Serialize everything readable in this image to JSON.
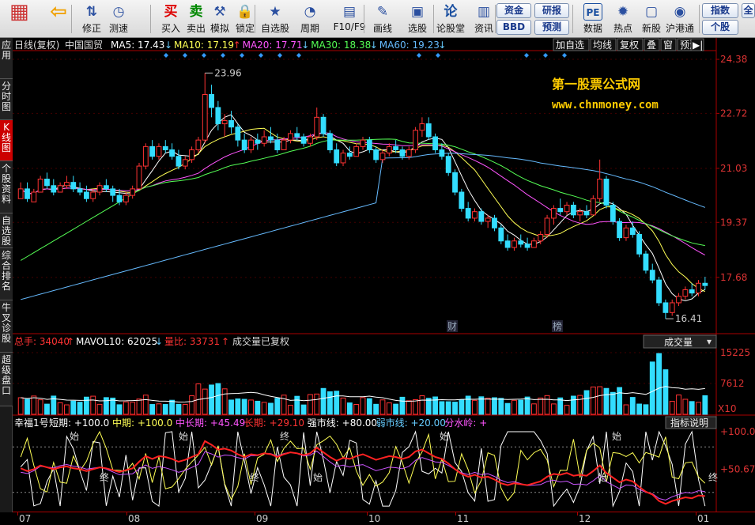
{
  "toolbar": {
    "items": [
      {
        "label": "",
        "icon": "grid-icon"
      },
      {
        "label": "",
        "icon": "back-arrow-icon"
      },
      {
        "label": "修正",
        "icon": "up-down-arrow-icon"
      },
      {
        "label": "测速",
        "icon": "clock-icon"
      },
      {
        "label": "买入",
        "icon": "buy-icon",
        "glyph": "买"
      },
      {
        "label": "卖出",
        "icon": "sell-icon",
        "glyph": "卖"
      },
      {
        "label": "模拟",
        "icon": "hammer-icon"
      },
      {
        "label": "锁定",
        "icon": "lock-icon"
      },
      {
        "label": "自选股",
        "icon": "star-folder-icon"
      },
      {
        "label": "周期",
        "icon": "cycle-icon"
      },
      {
        "label": "F10/F9",
        "icon": "f10-icon"
      },
      {
        "label": "画线",
        "icon": "pen-icon"
      },
      {
        "label": "选股",
        "icon": "select-icon"
      },
      {
        "label": "论股堂",
        "icon": "lungu-icon",
        "glyph": "论"
      },
      {
        "label": "资讯",
        "icon": "news-icon"
      },
      {
        "label": "数据",
        "icon": "pe-icon",
        "glyph": "PE"
      },
      {
        "label": "热点",
        "icon": "hot-icon"
      },
      {
        "label": "新股",
        "icon": "new-stock-icon"
      },
      {
        "label": "沪港通",
        "icon": "hk-connect-icon"
      }
    ],
    "pills": [
      "资金",
      "研报",
      "BBD",
      "预测",
      "指数",
      "个股",
      "全"
    ]
  },
  "left_tabs": [
    "应用",
    "分时图",
    "K线图",
    "个股资料",
    "自选股",
    "综合排名",
    "牛叉诊股",
    "超级盘口"
  ],
  "kline": {
    "period": "日线(复权)",
    "stock": "中国国贸",
    "ma": [
      {
        "name": "MA5",
        "value": "17.43",
        "color": "#ffffff"
      },
      {
        "name": "MA10",
        "value": "17.19",
        "color": "#ffff55"
      },
      {
        "name": "MA20",
        "value": "17.71",
        "color": "#ff55ff"
      },
      {
        "name": "MA30",
        "value": "18.38",
        "color": "#55ff55"
      },
      {
        "name": "MA60",
        "value": "19.23",
        "color": "#66bbff"
      }
    ],
    "right_buttons": [
      "加自选",
      "均线",
      "复权",
      "叠",
      "窗",
      "预测"
    ],
    "price_ticks": [
      "24.38",
      "22.72",
      "21.03",
      "19.37",
      "17.68"
    ],
    "high_label": "23.96",
    "low_label": "16.41",
    "event_marks": [
      "财",
      "榜"
    ],
    "watermark_title": "第一股票公式网",
    "watermark_url": "www.chnmoney.com"
  },
  "volume": {
    "total": "总手: 34040",
    "mavol": "MAVOL10: 62025",
    "ratio": "量比: 33731",
    "note": "成交量已复权",
    "select": "成交量",
    "ticks": [
      "15225",
      "7612",
      "X10"
    ]
  },
  "indicator": {
    "name": "幸福1号",
    "items": [
      {
        "label": "短期: +100.0",
        "color": "#ffffff"
      },
      {
        "label": "中期: +100.0",
        "color": "#ffff55"
      },
      {
        "label": "中长期: +45.49",
        "color": "#ff55ff"
      },
      {
        "label": "长期: +29.10",
        "color": "#ff3333"
      },
      {
        "label": "强市线: +80.00",
        "color": "#ffffff"
      },
      {
        "label": "弱市线: +20.00",
        "color": "#66ccff"
      },
      {
        "label": "分水岭: +",
        "color": "#ff55ff"
      }
    ],
    "help": "指标说明",
    "ticks": [
      "100.0",
      "50.67"
    ],
    "marks": [
      "始",
      "终",
      "始",
      "终",
      "终",
      "始",
      "始",
      "始",
      "始",
      "终"
    ]
  },
  "xaxis": [
    "07",
    "08",
    "09",
    "10",
    "11",
    "12",
    "01"
  ],
  "chart_data": {
    "type": "candlestick",
    "stock": "中国国贸",
    "note": "approximate daily OHLC read from chart",
    "ylim": [
      16.0,
      24.6
    ],
    "ohlc": [
      [
        20.1,
        20.6,
        20.3,
        20.4
      ],
      [
        20.4,
        20.6,
        20.0,
        20.1
      ],
      [
        20.0,
        20.4,
        20.2,
        20.3
      ],
      [
        20.3,
        20.8,
        20.6,
        20.7
      ],
      [
        20.7,
        20.9,
        20.4,
        20.5
      ],
      [
        20.5,
        20.7,
        20.2,
        20.3
      ],
      [
        20.3,
        20.6,
        20.4,
        20.5
      ],
      [
        20.5,
        20.8,
        20.4,
        20.6
      ],
      [
        20.6,
        20.8,
        20.3,
        20.4
      ],
      [
        20.4,
        20.6,
        20.2,
        20.3
      ],
      [
        20.3,
        20.5,
        20.0,
        20.1
      ],
      [
        20.1,
        20.4,
        20.0,
        20.3
      ],
      [
        20.3,
        20.6,
        20.2,
        20.5
      ],
      [
        20.5,
        20.7,
        20.3,
        20.4
      ],
      [
        20.4,
        20.5,
        20.0,
        20.2
      ],
      [
        20.2,
        20.4,
        19.9,
        20.0
      ],
      [
        20.0,
        20.3,
        19.9,
        20.2
      ],
      [
        20.2,
        20.5,
        20.1,
        20.4
      ],
      [
        20.4,
        21.2,
        20.4,
        21.1
      ],
      [
        21.1,
        21.8,
        21.0,
        21.7
      ],
      [
        21.7,
        21.9,
        21.3,
        21.4
      ],
      [
        21.4,
        21.8,
        21.3,
        21.7
      ],
      [
        21.7,
        21.9,
        21.5,
        21.6
      ],
      [
        21.6,
        21.8,
        21.3,
        21.4
      ],
      [
        21.4,
        21.6,
        21.0,
        21.1
      ],
      [
        21.1,
        21.4,
        21.0,
        21.3
      ],
      [
        21.3,
        21.7,
        21.2,
        21.6
      ],
      [
        21.6,
        22.0,
        21.5,
        21.9
      ],
      [
        21.9,
        23.96,
        21.8,
        23.3
      ],
      [
        23.3,
        23.6,
        22.6,
        22.9
      ],
      [
        22.9,
        23.1,
        22.2,
        22.4
      ],
      [
        22.4,
        22.7,
        22.0,
        22.5
      ],
      [
        22.5,
        22.8,
        22.1,
        22.3
      ],
      [
        22.3,
        22.4,
        21.7,
        21.9
      ],
      [
        21.9,
        22.1,
        21.5,
        21.6
      ],
      [
        21.6,
        22.0,
        21.5,
        21.9
      ],
      [
        21.9,
        22.1,
        21.6,
        21.8
      ],
      [
        21.8,
        22.2,
        21.7,
        22.0
      ],
      [
        22.0,
        22.3,
        21.8,
        21.9
      ],
      [
        21.9,
        22.1,
        21.5,
        21.6
      ],
      [
        21.6,
        22.0,
        21.6,
        21.9
      ],
      [
        21.9,
        22.2,
        21.8,
        22.1
      ],
      [
        22.1,
        22.3,
        21.9,
        22.0
      ],
      [
        22.0,
        22.1,
        21.7,
        21.8
      ],
      [
        21.8,
        22.1,
        21.7,
        22.0
      ],
      [
        22.0,
        22.9,
        21.9,
        22.6
      ],
      [
        22.6,
        22.7,
        22.0,
        22.1
      ],
      [
        22.1,
        22.2,
        21.5,
        21.6
      ],
      [
        21.6,
        21.8,
        21.1,
        21.2
      ],
      [
        21.2,
        21.6,
        21.1,
        21.5
      ],
      [
        21.5,
        21.7,
        21.3,
        21.4
      ],
      [
        21.4,
        21.8,
        21.4,
        21.7
      ],
      [
        21.7,
        22.0,
        21.6,
        21.9
      ],
      [
        21.9,
        22.0,
        21.5,
        21.6
      ],
      [
        21.6,
        21.7,
        21.2,
        21.3
      ],
      [
        21.3,
        21.6,
        21.2,
        21.5
      ],
      [
        21.5,
        21.8,
        21.4,
        21.7
      ],
      [
        21.7,
        21.9,
        21.5,
        21.6
      ],
      [
        21.6,
        21.7,
        21.3,
        21.4
      ],
      [
        21.4,
        21.7,
        21.3,
        21.6
      ],
      [
        21.6,
        22.3,
        21.5,
        22.2
      ],
      [
        22.2,
        22.6,
        22.0,
        22.4
      ],
      [
        22.4,
        22.6,
        21.9,
        22.0
      ],
      [
        22.0,
        22.1,
        21.5,
        21.6
      ],
      [
        21.6,
        21.8,
        21.3,
        21.4
      ],
      [
        21.4,
        21.5,
        20.8,
        20.9
      ],
      [
        20.9,
        21.0,
        20.2,
        20.3
      ],
      [
        20.3,
        20.4,
        19.7,
        19.8
      ],
      [
        19.8,
        20.0,
        19.4,
        19.5
      ],
      [
        19.5,
        19.8,
        19.4,
        19.7
      ],
      [
        19.7,
        19.8,
        19.3,
        19.4
      ],
      [
        19.4,
        19.6,
        19.2,
        19.5
      ],
      [
        19.5,
        19.6,
        19.1,
        19.2
      ],
      [
        19.2,
        19.3,
        18.7,
        18.8
      ],
      [
        18.8,
        19.0,
        18.5,
        18.6
      ],
      [
        18.6,
        18.9,
        18.5,
        18.8
      ],
      [
        18.8,
        19.0,
        18.6,
        18.7
      ],
      [
        18.7,
        18.9,
        18.5,
        18.6
      ],
      [
        18.6,
        18.9,
        18.6,
        18.8
      ],
      [
        18.8,
        19.1,
        18.7,
        19.0
      ],
      [
        19.0,
        19.6,
        18.9,
        19.5
      ],
      [
        19.5,
        19.9,
        19.3,
        19.8
      ],
      [
        19.8,
        20.1,
        19.6,
        19.7
      ],
      [
        19.7,
        20.0,
        19.6,
        19.9
      ],
      [
        19.9,
        20.0,
        19.5,
        19.6
      ],
      [
        19.6,
        19.8,
        19.4,
        19.7
      ],
      [
        19.7,
        19.9,
        19.5,
        19.6
      ],
      [
        19.6,
        20.2,
        19.6,
        20.1
      ],
      [
        20.1,
        21.3,
        20.0,
        20.7
      ],
      [
        20.7,
        20.8,
        19.8,
        19.9
      ],
      [
        19.9,
        20.0,
        19.3,
        19.4
      ],
      [
        19.4,
        19.5,
        18.8,
        18.9
      ],
      [
        18.9,
        19.3,
        18.8,
        19.2
      ],
      [
        19.2,
        19.4,
        18.9,
        19.0
      ],
      [
        19.0,
        19.1,
        18.3,
        18.4
      ],
      [
        18.4,
        18.5,
        17.8,
        17.9
      ],
      [
        17.9,
        18.1,
        17.5,
        17.6
      ],
      [
        17.6,
        17.7,
        16.8,
        16.9
      ],
      [
        16.9,
        17.0,
        16.41,
        16.6
      ],
      [
        16.6,
        17.0,
        16.5,
        16.9
      ],
      [
        16.9,
        17.2,
        16.8,
        17.1
      ],
      [
        17.1,
        17.4,
        17.0,
        17.3
      ],
      [
        17.3,
        17.5,
        17.1,
        17.2
      ],
      [
        17.2,
        17.6,
        17.1,
        17.5
      ],
      [
        17.5,
        17.7,
        17.3,
        17.43
      ]
    ]
  }
}
